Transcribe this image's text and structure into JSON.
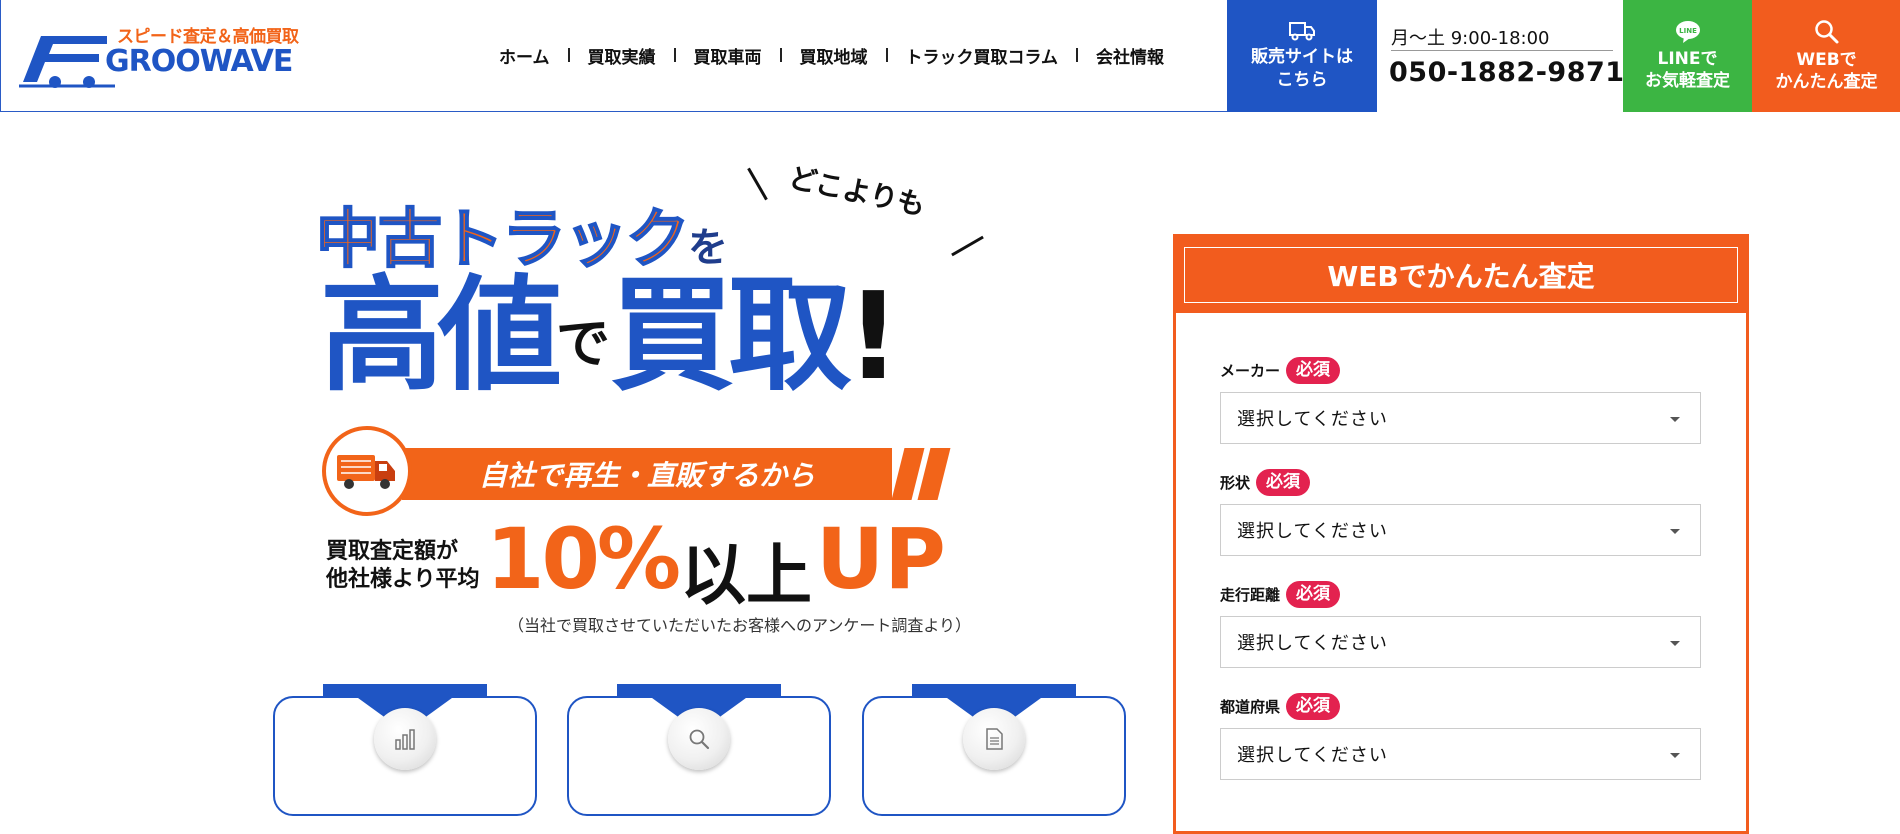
{
  "header": {
    "logo": {
      "tagline": "スピード査定＆高価買取",
      "wordmark": "GROOWAVE",
      "icon": "truck-logo-icon"
    },
    "nav": [
      {
        "label": "ホーム"
      },
      {
        "label": "買取実績"
      },
      {
        "label": "買取車両"
      },
      {
        "label": "買取地域"
      },
      {
        "label": "トラック買取コラム"
      },
      {
        "label": "会社情報"
      }
    ],
    "sales_button": {
      "label": "販売サイトは\nこちら",
      "icon": "truck-icon"
    },
    "phone": {
      "hours": "月〜土 9:00-18:00",
      "number": "050-1882-9871"
    },
    "line_button": {
      "label": "LINEで\nお気軽査定",
      "icon": "line-icon"
    },
    "web_button": {
      "label": "WEBで\nかんたん査定",
      "icon": "search-icon"
    }
  },
  "hero": {
    "sub": "どこよりも",
    "line1_main": "中古トラック",
    "line1_particle": "を",
    "line2_a": "高値",
    "line2_particle": "で",
    "line2_b": "買取",
    "line2_mark": "!",
    "ribbon": "自社で再生・直販するから",
    "stat_lead": "買取査定額が\n他社様より平均",
    "stat_number": "10%",
    "stat_unit": "以上",
    "stat_up": "UP",
    "note": "（当社で買取させていただいたお客様へのアンケート調査より）",
    "feature_icons": [
      "bar-chart-icon",
      "search-icon",
      "document-icon"
    ]
  },
  "form": {
    "title": "WEBでかんたん査定",
    "required_label": "必須",
    "fields": [
      {
        "label": "メーカー",
        "value": "選択してください"
      },
      {
        "label": "形状",
        "value": "選択してください"
      },
      {
        "label": "走行距離",
        "value": "選択してください"
      },
      {
        "label": "都道府県",
        "value": "選択してください"
      }
    ]
  },
  "colors": {
    "brand_blue": "#1f55c4",
    "brand_orange": "#f25c1e",
    "line_green": "#3cb543",
    "required_pink": "#e3224f"
  }
}
